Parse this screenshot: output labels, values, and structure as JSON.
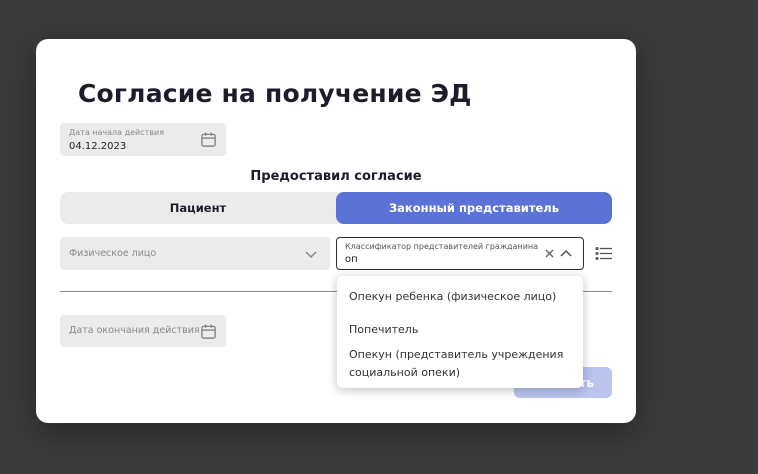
{
  "modal": {
    "title": "Согласие на получение ЭД",
    "start_date": {
      "label": "Дата начала действия",
      "value": "04.12.2023",
      "icon": "calendar-icon"
    },
    "consent_section": {
      "label": "Предоставил согласие"
    },
    "tabs": [
      {
        "label": "Пациент",
        "active": false
      },
      {
        "label": "Законный представитель",
        "active": true
      }
    ],
    "person_type_select": {
      "placeholder": "Физическое лицо"
    },
    "representative_combo": {
      "label": "Классификатор представителей гражданина",
      "value": "оп"
    },
    "end_date": {
      "placeholder": "Дата окончания действия",
      "icon": "calendar-icon"
    },
    "save_button": {
      "label": "…ить",
      "disabled": true
    }
  },
  "dropdown": {
    "options": [
      "Опекун ребенка (физическое лицо)",
      "Попечитель",
      "Опекун (представитель учреждения социальной опеки)"
    ]
  },
  "colors": {
    "backdrop": "#3b3b3b",
    "accent": "#5b73d6",
    "accent_disabled": "#b9c4ef",
    "field_bg": "#ebebeb"
  }
}
